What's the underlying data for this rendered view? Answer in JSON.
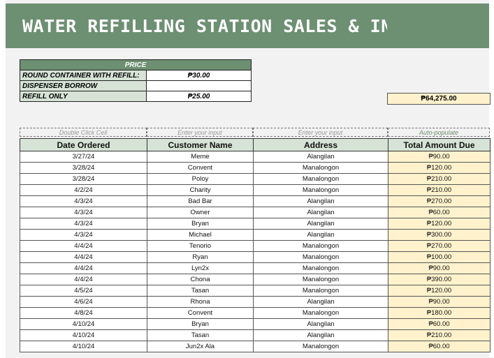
{
  "title": "WATER REFILLING STATION SALES & INVE",
  "price_table": {
    "header": "PRICE",
    "rows": [
      {
        "label": "ROUND CONTAINER WITH REFILL:",
        "value": "₱30.00"
      },
      {
        "label": "DISPENSER BORROW",
        "value": ""
      },
      {
        "label": "REFILL ONLY",
        "value": "₱25.00"
      }
    ]
  },
  "total": "₱64,275.00",
  "hints": [
    "Double Click Cell",
    "Enter your input",
    "Enter your input",
    "Auto-populate"
  ],
  "columns": [
    "Date Ordered",
    "Customer Name",
    "Address",
    "Total Amount Due"
  ],
  "rows": [
    [
      "3/27/24",
      "Meme",
      "Alangilan",
      "₱90.00"
    ],
    [
      "3/28/24",
      "Convent",
      "Manalongon",
      "₱120.00"
    ],
    [
      "3/28/24",
      "Poloy",
      "Manalongon",
      "₱210.00"
    ],
    [
      "4/2/24",
      "Charity",
      "Manalongon",
      "₱210.00"
    ],
    [
      "4/3/24",
      "Bad Bar",
      "Alangilan",
      "₱270.00"
    ],
    [
      "4/3/24",
      "Owner",
      "Alangilan",
      "₱60.00"
    ],
    [
      "4/3/24",
      "Bryan",
      "Alangilan",
      "₱120.00"
    ],
    [
      "4/3/24",
      "Michael",
      "Alangilan",
      "₱300.00"
    ],
    [
      "4/4/24",
      "Tenorio",
      "Manalongon",
      "₱270.00"
    ],
    [
      "4/4/24",
      "Ryan",
      "Manalongon",
      "₱100.00"
    ],
    [
      "4/4/24",
      "Lyn2x",
      "Manalongon",
      "₱90.00"
    ],
    [
      "4/4/24",
      "Chona",
      "Manalongon",
      "₱390.00"
    ],
    [
      "4/5/24",
      "Tasan",
      "Manalongon",
      "₱120.00"
    ],
    [
      "4/6/24",
      "Rhona",
      "Alangilan",
      "₱90.00"
    ],
    [
      "4/8/24",
      "Convent",
      "Manalongon",
      "₱180.00"
    ],
    [
      "4/10/24",
      "Bryan",
      "Alangilan",
      "₱60.00"
    ],
    [
      "4/10/24",
      "Tasan",
      "Alangilan",
      "₱210.00"
    ],
    [
      "4/10/24",
      "Jun2x Ala",
      "Manalongon",
      "₱60.00"
    ]
  ],
  "colors": {
    "banner": "#6d8f72",
    "label_fill": "#d6e3d6",
    "amount_fill": "#fff2cc"
  }
}
